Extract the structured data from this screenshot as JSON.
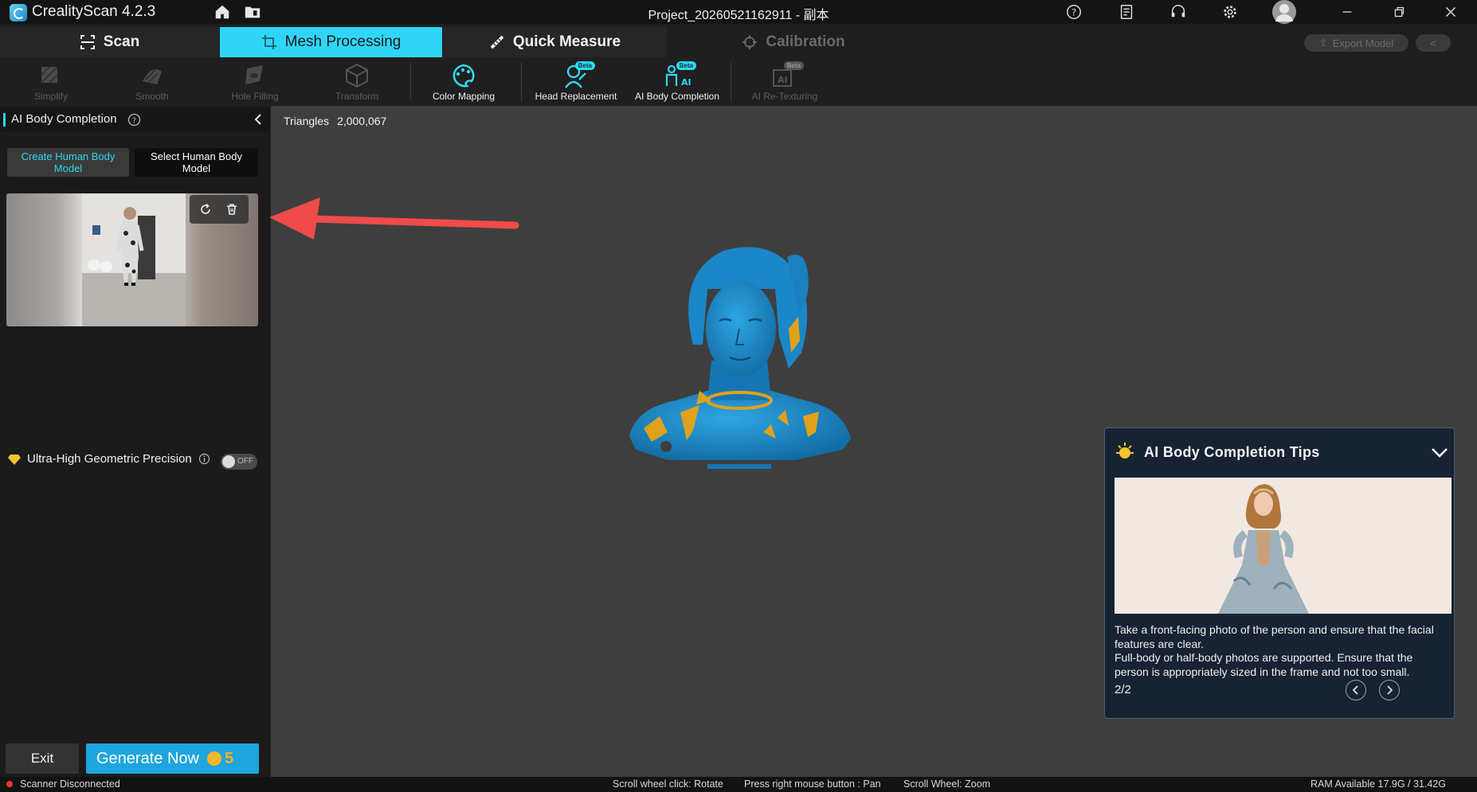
{
  "titlebar": {
    "app_name": "CrealityScan 4.2.3",
    "project": "Project_20260521162911 - 副本"
  },
  "tabs": [
    {
      "label": "Scan"
    },
    {
      "label": "Mesh Processing"
    },
    {
      "label": "Quick Measure"
    },
    {
      "label": "Calibration"
    }
  ],
  "header_buttons": {
    "export": "Export Model"
  },
  "tools": [
    {
      "label": "Simplify"
    },
    {
      "label": "Smooth"
    },
    {
      "label": "Hole Filling"
    },
    {
      "label": "Transform"
    },
    {
      "label": "Color Mapping"
    },
    {
      "label": "Head Replacement",
      "badge": "Beta"
    },
    {
      "label": "AI Body Completion",
      "badge": "Beta"
    },
    {
      "label": "AI Re-Texturing",
      "badge": "Beta"
    }
  ],
  "left_panel": {
    "title": "AI Body Completion",
    "create_btn": "Create Human Body Model",
    "select_btn": "Select Human Body Model",
    "ultra_label": "Ultra-High Geometric Precision",
    "toggle_state": "OFF",
    "exit": "Exit",
    "generate": "Generate Now",
    "generate_cost": "5"
  },
  "viewport": {
    "triangles_label": "Triangles",
    "triangles_value": "2,000,067"
  },
  "tips": {
    "title": "AI Body Completion Tips",
    "text1": "Take a front-facing photo of the person and ensure that the facial features are clear.",
    "text2": "Full-body or half-body photos are supported. Ensure that the person is appropriately sized in the frame and not too small.",
    "page": "2/2"
  },
  "status": {
    "scanner": "Scanner Disconnected",
    "rotate": "Scroll wheel click: Rotate",
    "pan": "Press right mouse button : Pan",
    "zoom": "Scroll Wheel: Zoom",
    "ram": "RAM Available 17.9G / 31.42G"
  },
  "colors": {
    "accent": "#2fd5f7",
    "mesh_blue": "#1a8ccf",
    "mesh_gold": "#e0a21c",
    "arrow": "#ef4b4b"
  }
}
